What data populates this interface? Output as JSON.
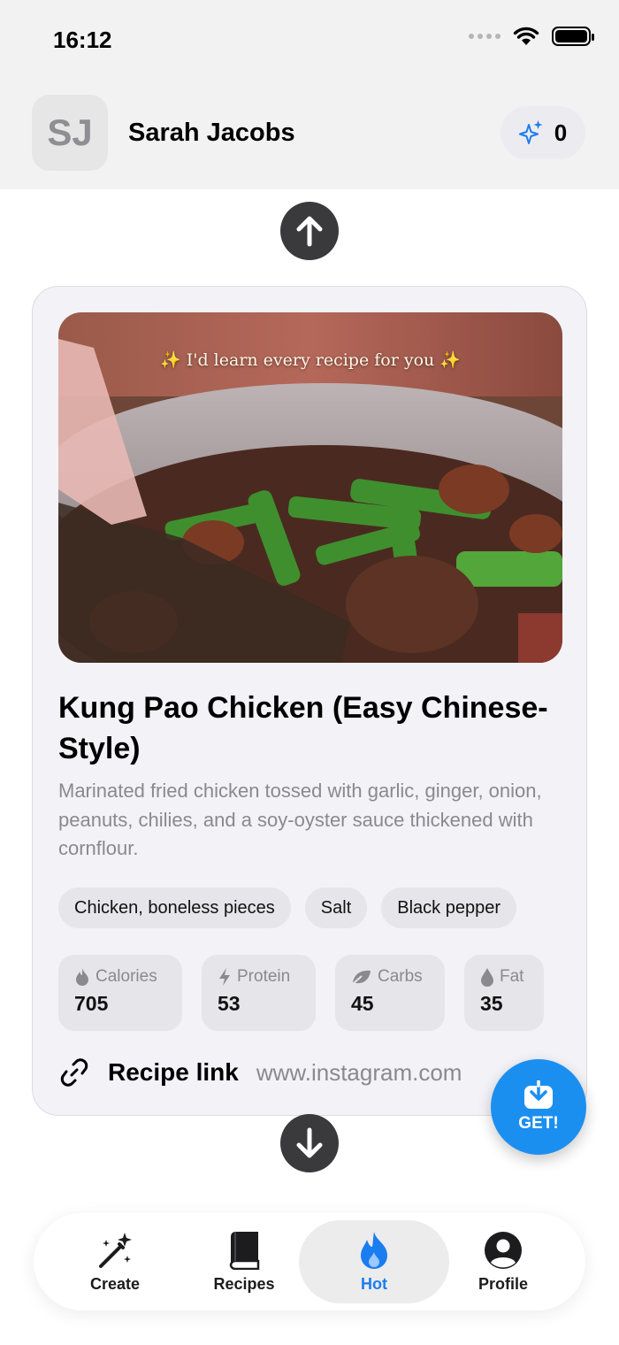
{
  "status_bar": {
    "time": "16:12"
  },
  "header": {
    "avatar_initials": "SJ",
    "user_name": "Sarah Jacobs",
    "credits": "0"
  },
  "recipe": {
    "image_caption": "✨ I'd learn every recipe for you ✨",
    "title": "Kung Pao Chicken (Easy Chinese-Style)",
    "description": "Marinated fried chicken tossed with garlic, ginger, onion, peanuts, chilies, and a soy-oyster sauce thickened with cornflour.",
    "ingredients": [
      "Chicken, boneless pieces",
      "Salt",
      "Black pepper"
    ],
    "nutrition": [
      {
        "label": "Calories",
        "value": "705",
        "icon": "flame-icon"
      },
      {
        "label": "Protein",
        "value": "53",
        "icon": "bolt-icon"
      },
      {
        "label": "Carbs",
        "value": "45",
        "icon": "leaf-icon"
      },
      {
        "label": "Fat",
        "value": "35",
        "icon": "drop-icon"
      }
    ],
    "link_label": "Recipe link",
    "link_url": "www.instagram.com"
  },
  "get_button": {
    "label": "GET!"
  },
  "tabs": [
    {
      "label": "Create",
      "icon": "magic-wand-icon"
    },
    {
      "label": "Recipes",
      "icon": "book-icon"
    },
    {
      "label": "Hot",
      "icon": "flame-icon",
      "active": true
    },
    {
      "label": "Profile",
      "icon": "profile-icon"
    }
  ],
  "colors": {
    "accent": "#1b8ff0",
    "active_tab": "#1a7df0",
    "card_bg": "#f2f2f7",
    "arrow_bg": "#3a3a3c"
  }
}
